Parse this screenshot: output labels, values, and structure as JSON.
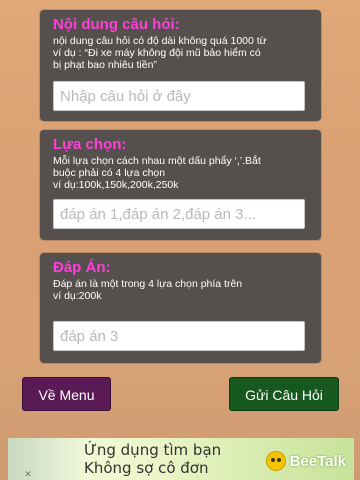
{
  "question": {
    "title": "Nội dung câu hỏi:",
    "line1": "nội dung câu hỏi có độ dài không quá 1000 từ",
    "line2": "ví dụ : “Đi xe máy không đội mũ bảo hiểm có",
    "line3": "bị phạt bao nhiêu tiền”",
    "placeholder": "Nhập câu hỏi ở đây",
    "value": ""
  },
  "choices": {
    "title": "Lựa chọn:",
    "line1": "Mỗi lựa chọn cách nhau một dấu phẩy ‘,’.Bắt",
    "line2": "buộc phải có 4 lựa chọn",
    "line3": "ví dụ:100k,150k,200k,250k",
    "placeholder": "đáp án 1,đáp án 2,đáp án 3...",
    "value": ""
  },
  "answer": {
    "title": "Đáp Án:",
    "line1": "Đáp án là một trong 4 lựa chọn phía trên",
    "line2": "ví dụ:200k",
    "placeholder": "đáp án 3",
    "value": ""
  },
  "buttons": {
    "menu_label": "Về Menu",
    "send_label": "Gửi Câu Hỏi"
  },
  "ad": {
    "line1": "Ứng dụng tìm bạn",
    "line2": "Không sợ cô đơn",
    "brand": "BeeTalk",
    "close": "✕",
    "brand_icon": "bee-icon"
  },
  "colors": {
    "title_accent": "#ff3fd9",
    "card_bg": "#55504d",
    "menu_button": "#5a1a55",
    "send_button": "#16581e"
  }
}
